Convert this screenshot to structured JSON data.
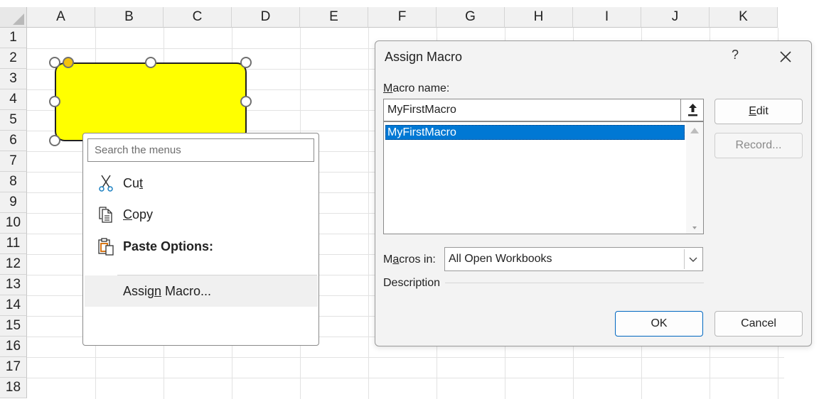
{
  "sheet": {
    "columns": [
      "A",
      "B",
      "C",
      "D",
      "E",
      "F",
      "G",
      "H",
      "I",
      "J",
      "K"
    ],
    "rows": [
      "1",
      "2",
      "3",
      "4",
      "5",
      "6",
      "7",
      "8",
      "9",
      "10",
      "11",
      "12",
      "13",
      "14",
      "15",
      "16",
      "17",
      "18"
    ]
  },
  "shape": {
    "fill": "#ffff00"
  },
  "context_menu": {
    "search_placeholder": "Search the menus",
    "items": [
      {
        "icon": "scissors-icon",
        "label_pre": "Cu",
        "label_u": "t",
        "label_post": ""
      },
      {
        "icon": "copy-icon",
        "label_pre": "",
        "label_u": "C",
        "label_post": "opy"
      },
      {
        "icon": "clipboard-icon",
        "label": "Paste Options:"
      },
      {
        "label_pre": "Assig",
        "label_u": "n",
        "label_post": " Macro..."
      }
    ]
  },
  "dialog": {
    "title": "Assign Macro",
    "help": "?",
    "macro_name_label_u": "M",
    "macro_name_label_rest": "acro name:",
    "macro_name_value": "MyFirstMacro",
    "macros": [
      "MyFirstMacro"
    ],
    "edit_label_u": "E",
    "edit_label_rest": "dit",
    "record_label": "Record...",
    "macros_in_label_pre": "M",
    "macros_in_label_u": "a",
    "macros_in_label_post": "cros in:",
    "macros_in_value": "All Open Workbooks",
    "description_label": "Description",
    "ok_label": "OK",
    "cancel_label": "Cancel",
    "accent_color": "#0078d4"
  }
}
